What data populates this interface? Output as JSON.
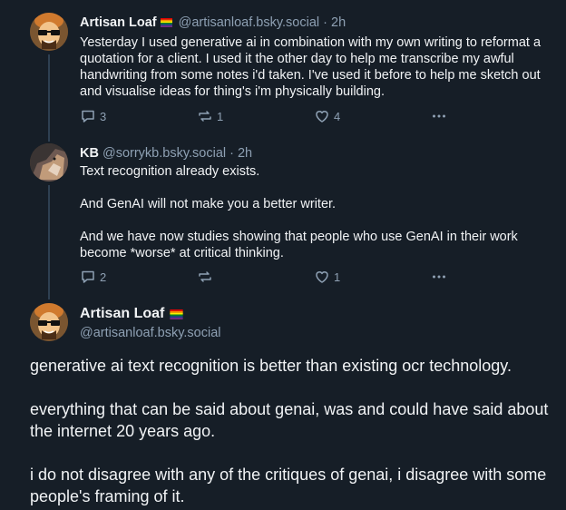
{
  "posts": [
    {
      "author": "Artisan Loaf",
      "handle": "@artisanloaf.bsky.social",
      "time": "· 2h",
      "paragraphs": [
        "Yesterday I used generative ai in combination with my own writing to reformat a quotation for a client. I used it the other day to help me transcribe my awful handwriting from some notes i'd taken. I've used it before to help me sketch out and visualise ideas for thing's i'm physically building."
      ],
      "replies": "3",
      "reposts": "1",
      "likes": "4"
    },
    {
      "author": "KB",
      "handle": "@sorrykb.bsky.social",
      "time": "· 2h",
      "paragraphs": [
        "Text recognition already exists.",
        "And GenAI will not make you a better writer.",
        "And we have now studies showing that people who use GenAI in their work become *worse* at critical thinking."
      ],
      "replies": "2",
      "reposts": "",
      "likes": "1"
    }
  ],
  "main_post": {
    "author": "Artisan Loaf",
    "handle": "@artisanloaf.bsky.social",
    "paragraphs": [
      "generative ai text recognition is better than existing ocr technology.",
      "everything that can be said about genai, was and could have said about the internet 20 years ago.",
      "i do not disagree with any of the critiques of genai, i disagree with some people's framing of it."
    ]
  },
  "colors": {
    "background": "#161e27",
    "text": "#f1f3f5",
    "muted": "#8ea0b3",
    "thread_line": "#2e4052"
  },
  "icons": [
    "reply-icon",
    "repost-icon",
    "like-icon",
    "more-icon",
    "pride-flag-icon"
  ]
}
